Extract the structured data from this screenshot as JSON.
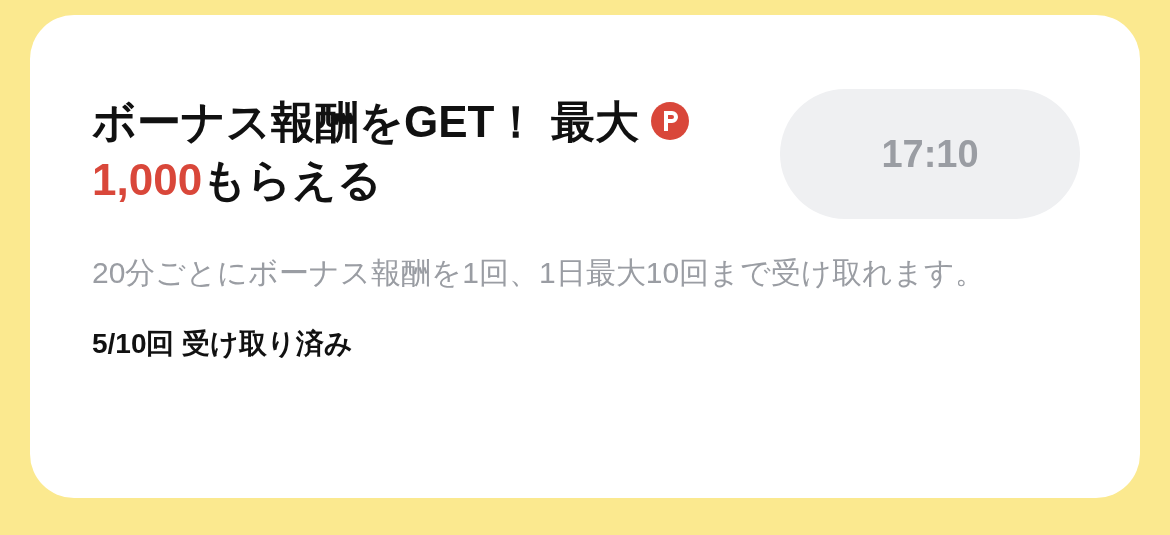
{
  "card": {
    "title": {
      "prefix": "ボーナス報酬をGET！ 最大",
      "amount": "1,000",
      "suffix": "もらえる"
    },
    "timer": {
      "label": "17:10",
      "disabled": true
    },
    "description": "20分ごとにボーナス報酬を1回、1日最大10回まで受け取れます。",
    "progress": "5/10回 受け取り済み"
  }
}
